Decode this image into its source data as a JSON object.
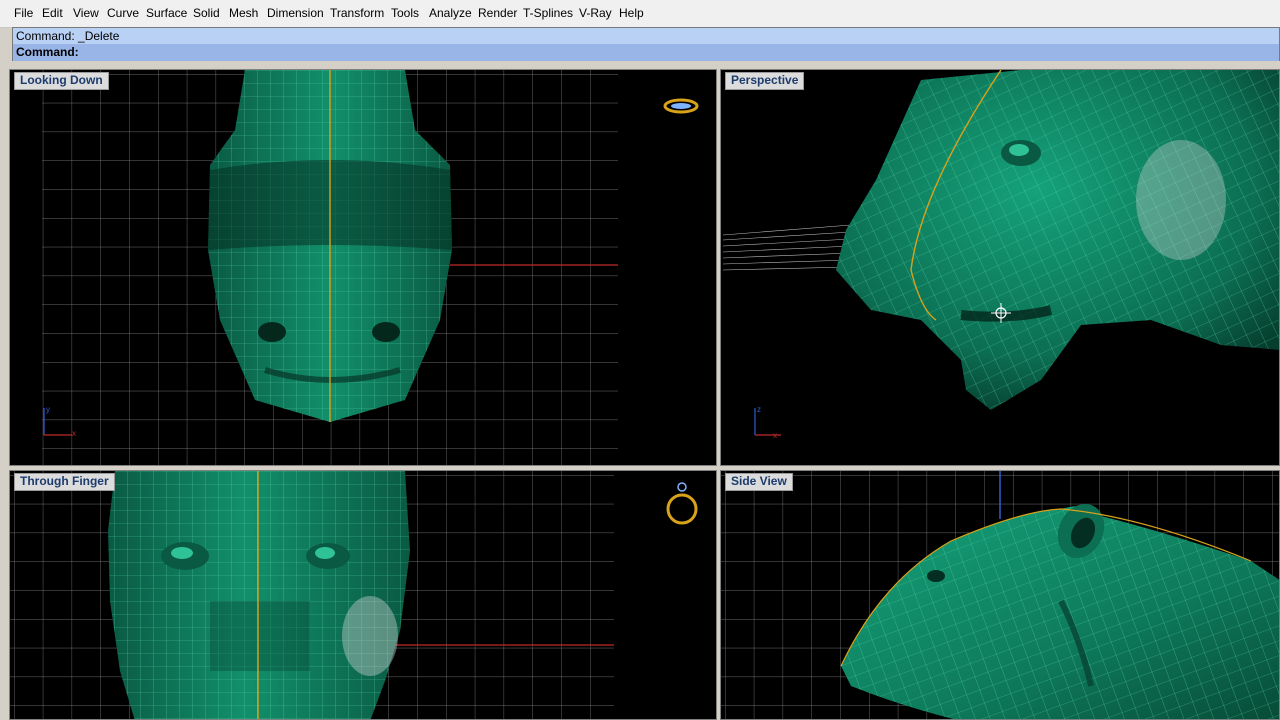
{
  "menubar": {
    "items": [
      "File",
      "Edit",
      "View",
      "Curve",
      "Surface",
      "Solid",
      "Mesh",
      "Dimension",
      "Transform",
      "Tools",
      "Analyze",
      "Render",
      "T-Splines",
      "V-Ray",
      "Help"
    ]
  },
  "command": {
    "history": "Command: _Delete",
    "prompt": "Command:"
  },
  "viewports": {
    "top_left": {
      "label": "Looking Down"
    },
    "top_right": {
      "label": "Perspective"
    },
    "bottom_left": {
      "label": "Through Finger"
    },
    "bottom_right": {
      "label": "Side View"
    }
  },
  "colors": {
    "model": "#0f7d5e",
    "model_dark": "#06402f",
    "wire": "#5de0ae",
    "grid": "#9a9a9a",
    "seam": "#d9a21b",
    "x_axis": "#c0282a",
    "y_axis": "#2f5fcf",
    "label_text": "#1d3c6e"
  },
  "icons": [
    "ring-oval-icon",
    "ring-icon",
    "gumball-icon",
    "axis-icon"
  ]
}
